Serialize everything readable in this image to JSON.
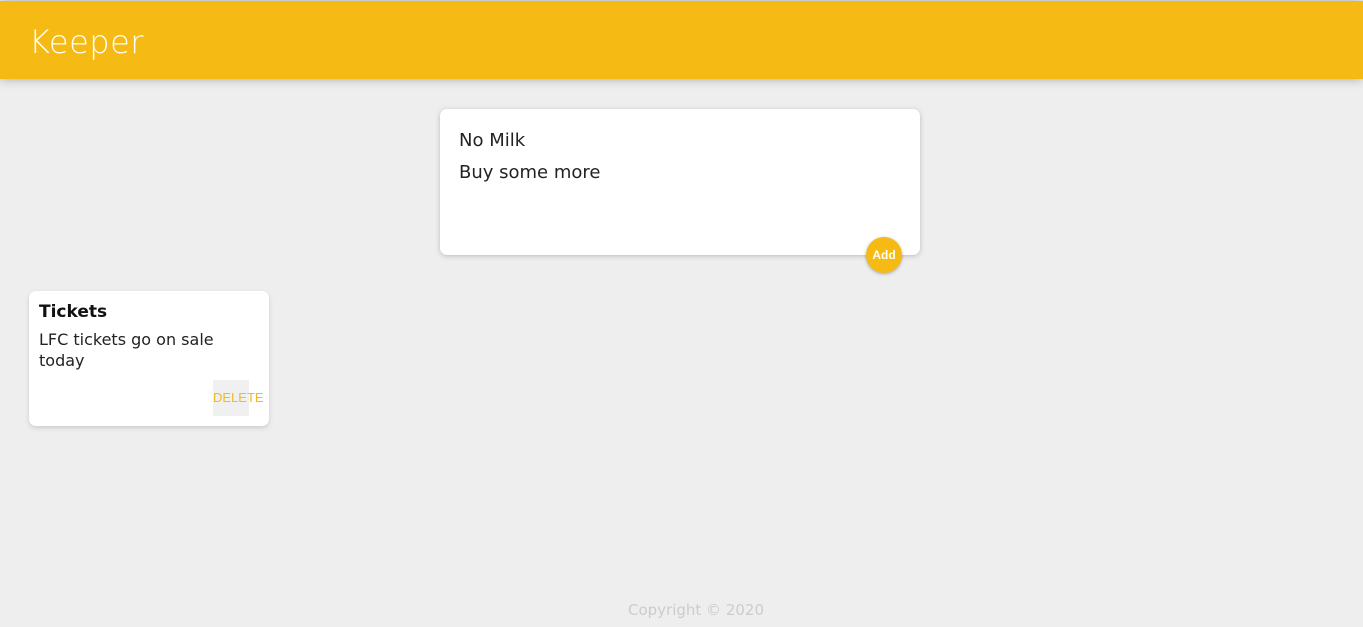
{
  "header": {
    "title": "Keeper"
  },
  "create_note": {
    "title_value": "No Milk",
    "content_value": "Buy some more",
    "add_label": "Add"
  },
  "notes": [
    {
      "title": "Tickets",
      "content": "LFC tickets go on sale today",
      "delete_label": "DELETE"
    }
  ],
  "footer": {
    "text": "Copyright © 2020"
  },
  "colors": {
    "accent": "#f5ba13",
    "background": "#eeeeee"
  }
}
